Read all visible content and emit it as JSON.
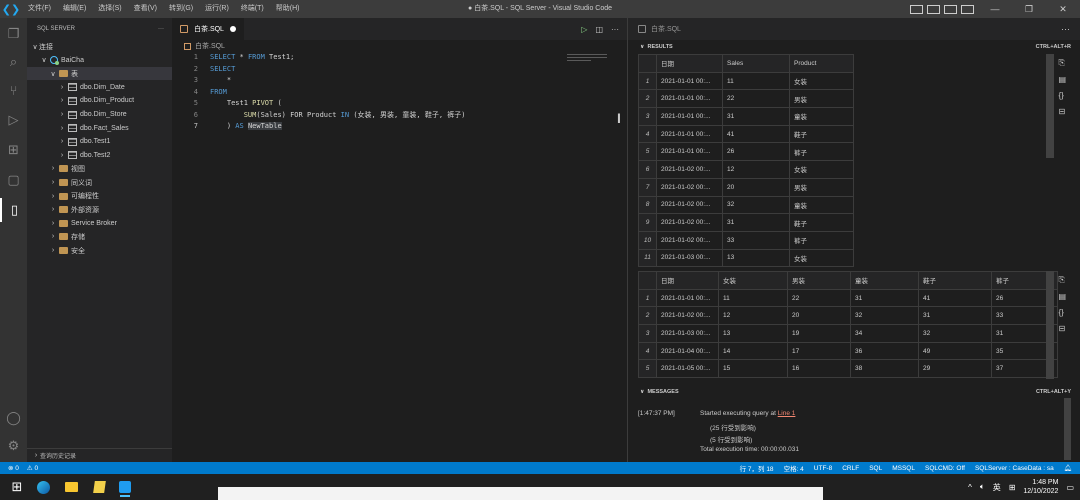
{
  "titlebar": {
    "menu": [
      "文件(F)",
      "编辑(E)",
      "选择(S)",
      "查看(V)",
      "转到(G)",
      "运行(R)",
      "终端(T)",
      "帮助(H)"
    ],
    "title": "● 白茶.SQL - SQL Server - Visual Studio Code",
    "win_min": "—",
    "win_max": "❐",
    "win_close": "✕"
  },
  "sidebar": {
    "title": "SQL SERVER",
    "more": "···",
    "tree": [
      {
        "label": "连接",
        "indent": 0,
        "chev": "∨",
        "icon": "none"
      },
      {
        "label": "BaiCha",
        "indent": 1,
        "chev": "∨",
        "icon": "server"
      },
      {
        "label": "表",
        "indent": 2,
        "chev": "∨",
        "icon": "folder",
        "selected": true
      },
      {
        "label": "dbo.Dim_Date",
        "indent": 3,
        "chev": "›",
        "icon": "table"
      },
      {
        "label": "dbo.Dim_Product",
        "indent": 3,
        "chev": "›",
        "icon": "table"
      },
      {
        "label": "dbo.Dim_Store",
        "indent": 3,
        "chev": "›",
        "icon": "table"
      },
      {
        "label": "dbo.Fact_Sales",
        "indent": 3,
        "chev": "›",
        "icon": "table"
      },
      {
        "label": "dbo.Test1",
        "indent": 3,
        "chev": "›",
        "icon": "table"
      },
      {
        "label": "dbo.Test2",
        "indent": 3,
        "chev": "›",
        "icon": "table"
      },
      {
        "label": "视图",
        "indent": 2,
        "chev": "›",
        "icon": "folder"
      },
      {
        "label": "同义词",
        "indent": 2,
        "chev": "›",
        "icon": "folder"
      },
      {
        "label": "可编程性",
        "indent": 2,
        "chev": "›",
        "icon": "folder"
      },
      {
        "label": "外部资源",
        "indent": 2,
        "chev": "›",
        "icon": "folder"
      },
      {
        "label": "Service Broker",
        "indent": 2,
        "chev": "›",
        "icon": "folder"
      },
      {
        "label": "存储",
        "indent": 2,
        "chev": "›",
        "icon": "folder"
      },
      {
        "label": "安全",
        "indent": 2,
        "chev": "›",
        "icon": "folder"
      }
    ],
    "footer": "查询历史记录"
  },
  "editor": {
    "tab_label": "白茶.SQL",
    "breadcrumb": "白茶.SQL",
    "lines": [
      {
        "n": "1",
        "tokens": [
          {
            "t": "SELECT",
            "c": "k"
          },
          {
            "t": " * ",
            "c": "id"
          },
          {
            "t": "FROM",
            "c": "k"
          },
          {
            "t": " Test1;",
            "c": "id"
          }
        ]
      },
      {
        "n": "2",
        "tokens": [
          {
            "t": "SELECT",
            "c": "k"
          }
        ]
      },
      {
        "n": "3",
        "tokens": [
          {
            "t": "    *",
            "c": "id"
          }
        ]
      },
      {
        "n": "4",
        "tokens": [
          {
            "t": "FROM",
            "c": "k"
          }
        ]
      },
      {
        "n": "5",
        "tokens": [
          {
            "t": "    Test1 ",
            "c": "id"
          },
          {
            "t": "PIVOT",
            "c": "f"
          },
          {
            "t": " (",
            "c": "id"
          }
        ]
      },
      {
        "n": "6",
        "tokens": [
          {
            "t": "        ",
            "c": "id"
          },
          {
            "t": "SUM",
            "c": "f"
          },
          {
            "t": "(Sales) FOR Product ",
            "c": "id"
          },
          {
            "t": "IN",
            "c": "k"
          },
          {
            "t": " (女装, 男装, 童装, 鞋子, 裤子)",
            "c": "id"
          }
        ]
      },
      {
        "n": "7",
        "tokens": [
          {
            "t": "    ) ",
            "c": "id"
          },
          {
            "t": "AS",
            "c": "k"
          },
          {
            "t": " ",
            "c": "id"
          },
          {
            "t": "NewTable",
            "c": "id",
            "hl": true
          }
        ],
        "current": true
      }
    ]
  },
  "results": {
    "tab_label": "白茶.SQL",
    "results_title": "RESULTS",
    "results_shortcut": "CTRL+ALT+R",
    "messages_title": "MESSAGES",
    "messages_shortcut": "CTRL+ALT+Y",
    "grid1": {
      "headers": [
        "日期",
        "Sales",
        "Product"
      ],
      "rows": [
        [
          "1",
          "2021-01-01 00:...",
          "11",
          "女装"
        ],
        [
          "2",
          "2021-01-01 00:...",
          "22",
          "男装"
        ],
        [
          "3",
          "2021-01-01 00:...",
          "31",
          "童装"
        ],
        [
          "4",
          "2021-01-01 00:...",
          "41",
          "鞋子"
        ],
        [
          "5",
          "2021-01-01 00:...",
          "26",
          "裤子"
        ],
        [
          "6",
          "2021-01-02 00:...",
          "12",
          "女装"
        ],
        [
          "7",
          "2021-01-02 00:...",
          "20",
          "男装"
        ],
        [
          "8",
          "2021-01-02 00:...",
          "32",
          "童装"
        ],
        [
          "9",
          "2021-01-02 00:...",
          "31",
          "鞋子"
        ],
        [
          "10",
          "2021-01-02 00:...",
          "33",
          "裤子"
        ],
        [
          "11",
          "2021-01-03 00:...",
          "13",
          "女装"
        ]
      ]
    },
    "grid2": {
      "headers": [
        "日期",
        "女装",
        "男装",
        "童装",
        "鞋子",
        "裤子"
      ],
      "rows": [
        [
          "1",
          "2021-01-01 00:...",
          "11",
          "22",
          "31",
          "41",
          "26"
        ],
        [
          "2",
          "2021-01-02 00:...",
          "12",
          "20",
          "32",
          "31",
          "33"
        ],
        [
          "3",
          "2021-01-03 00:...",
          "13",
          "19",
          "34",
          "32",
          "31"
        ],
        [
          "4",
          "2021-01-04 00:...",
          "14",
          "17",
          "36",
          "49",
          "35"
        ],
        [
          "5",
          "2021-01-05 00:...",
          "15",
          "16",
          "38",
          "29",
          "37"
        ]
      ]
    },
    "messages": {
      "time": "[1:47:37 PM]",
      "started_prefix": "Started executing query at ",
      "started_link": "Line 1",
      "affected1": "(25 行受到影响)",
      "affected2": "(5 行受到影响)",
      "total": "Total execution time: 00:00:00.031"
    }
  },
  "statusbar": {
    "errors": "⊗ 0",
    "warnings": "⚠ 0",
    "position": "行 7，列 18",
    "spaces": "空格: 4",
    "encoding": "UTF-8",
    "eol": "CRLF",
    "language": "SQL",
    "provider": "MSSQL",
    "sqlcmd": "SQLCMD: Off",
    "connection": "SQLServer : CaseData : sa"
  },
  "taskbar": {
    "time": "1:48 PM",
    "date": "12/10/2022",
    "ime": "英"
  }
}
